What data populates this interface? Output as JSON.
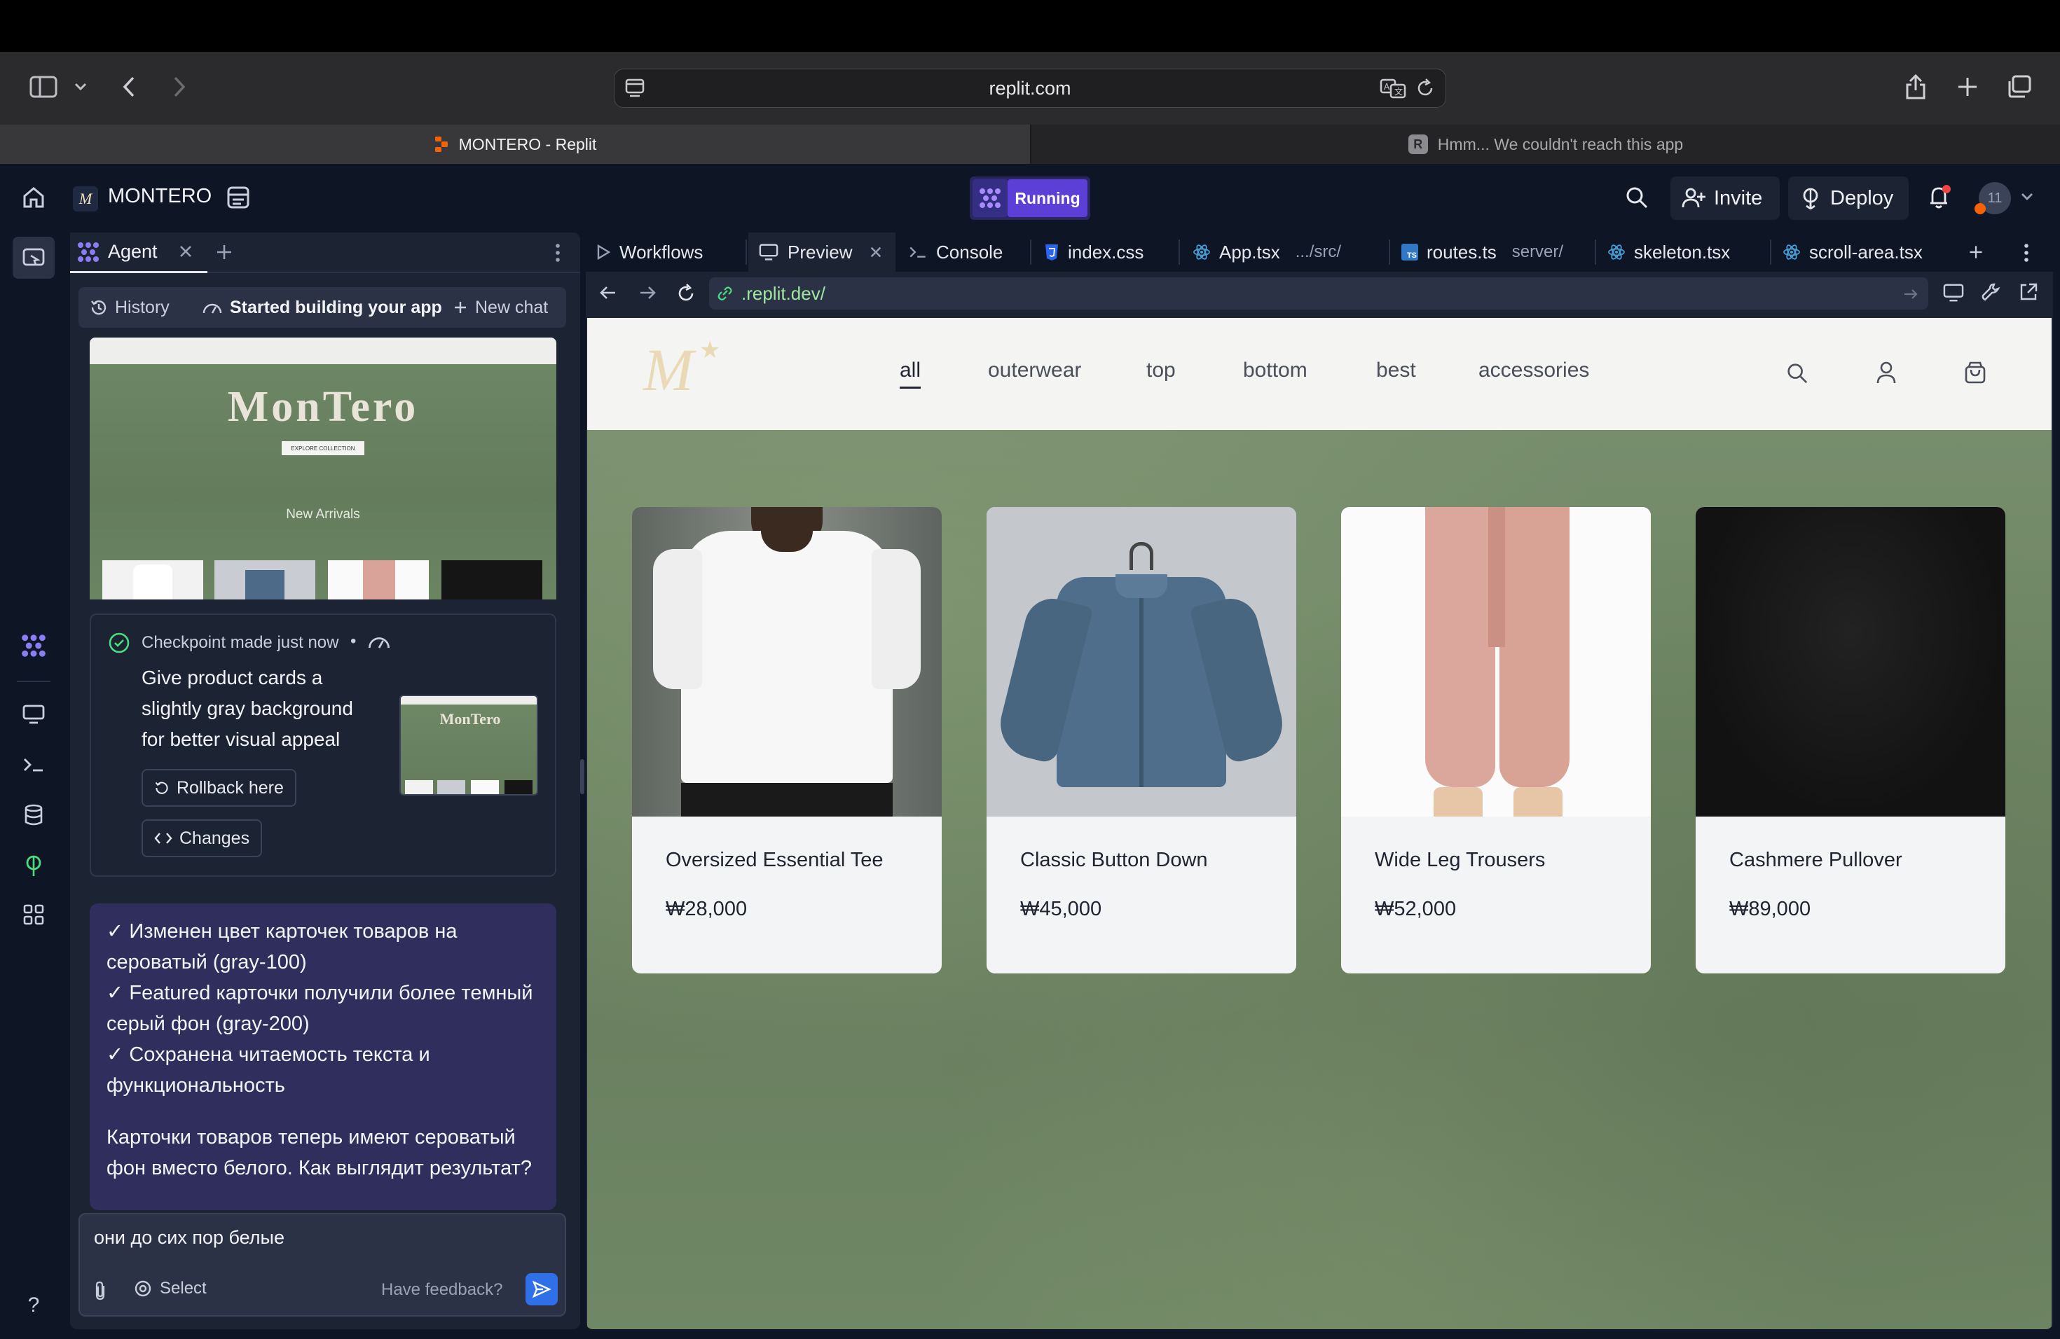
{
  "browser": {
    "url": "replit.com",
    "tabs": [
      {
        "label": "MONTERO - Replit",
        "active": true
      },
      {
        "label": "Hmm... We couldn't reach this app",
        "active": false
      }
    ]
  },
  "topbar": {
    "project_name": "MONTERO",
    "status_label": "Running",
    "invite_label": "Invite",
    "deploy_label": "Deploy",
    "avatar_label": "11"
  },
  "agent_panel": {
    "tab_label": "Agent",
    "history_label": "History",
    "session_title": "Started building your app",
    "new_chat_label": "New chat",
    "screenshot": {
      "brand": "MonTero",
      "cta": "EXPLORE COLLECTION",
      "section": "New Arrivals"
    },
    "checkpoint": {
      "title": "Checkpoint made just now",
      "separator": "•",
      "description": "Give product cards a slightly gray background for better visual appeal",
      "thumb_brand": "MonTero",
      "rollback_label": "Rollback here",
      "changes_label": "Changes"
    },
    "agent_message": {
      "lines": [
        "✓ Изменен цвет карточек товаров на сероватый (gray-100)",
        "✓ Featured карточки получили более темный серый фон (gray-200)",
        "✓ Сохранена читаемость текста и функциональность"
      ],
      "summary": "Карточки товаров теперь имеют сероватый фон вместо белого. Как выглядит результат?"
    },
    "input": {
      "value": "они до сих пор белые",
      "select_label": "Select",
      "feedback_label": "Have feedback?"
    }
  },
  "workspace": {
    "tabs": [
      {
        "label": "Workflows",
        "sub": ""
      },
      {
        "label": "Preview",
        "sub": ""
      },
      {
        "label": "Console",
        "sub": ""
      },
      {
        "label": "index.css",
        "sub": ""
      },
      {
        "label": "App.tsx",
        "sub": ".../src/"
      },
      {
        "label": "routes.ts",
        "sub": "server/"
      },
      {
        "label": "skeleton.tsx",
        "sub": ""
      },
      {
        "label": "scroll-area.tsx",
        "sub": ""
      }
    ],
    "preview_url": ".replit.dev/"
  },
  "site": {
    "nav": [
      "all",
      "outerwear",
      "top",
      "bottom",
      "best",
      "accessories"
    ],
    "products": [
      {
        "name": "Oversized Essential Tee",
        "price": "₩28,000"
      },
      {
        "name": "Classic Button Down",
        "price": "₩45,000"
      },
      {
        "name": "Wide Leg Trousers",
        "price": "₩52,000"
      },
      {
        "name": "Cashmere Pullover",
        "price": "₩89,000"
      }
    ]
  },
  "colors": {
    "replit_bg": "#0e1525",
    "panel_bg": "#1c2333",
    "running_purple": "#5b3fd6",
    "agent_message_bg": "#2f2e5c",
    "send_button": "#2f6fe8"
  }
}
